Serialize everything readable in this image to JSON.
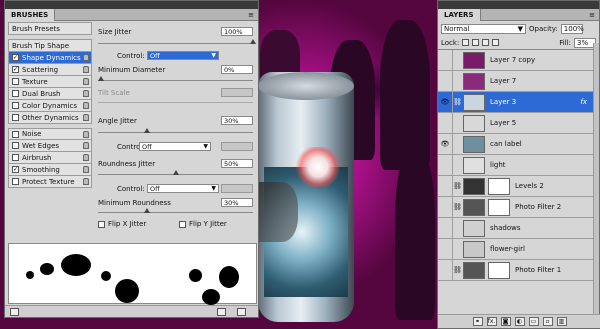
{
  "brushes_panel": {
    "tab": "BRUSHES",
    "presets_label": "Brush Presets",
    "tip_shape_label": "Brush Tip Shape",
    "options": [
      {
        "label": "Shape Dynamics",
        "checked": true,
        "selected": true
      },
      {
        "label": "Scattering",
        "checked": true,
        "selected": false
      },
      {
        "label": "Texture",
        "checked": false,
        "selected": false
      },
      {
        "label": "Dual Brush",
        "checked": false,
        "selected": false
      },
      {
        "label": "Color Dynamics",
        "checked": false,
        "selected": false
      },
      {
        "label": "Other Dynamics",
        "checked": false,
        "selected": false
      },
      {
        "label": "Noise",
        "checked": false,
        "selected": false
      },
      {
        "label": "Wet Edges",
        "checked": false,
        "selected": false
      },
      {
        "label": "Airbrush",
        "checked": false,
        "selected": false
      },
      {
        "label": "Smoothing",
        "checked": true,
        "selected": false
      },
      {
        "label": "Protect Texture",
        "checked": false,
        "selected": false
      }
    ],
    "size_jitter_label": "Size Jitter",
    "size_jitter_value": "100%",
    "control_label": "Control:",
    "control1_value": "Off",
    "min_diameter_label": "Minimum Diameter",
    "min_diameter_value": "0%",
    "tilt_scale_label": "Tilt Scale",
    "angle_jitter_label": "Angle Jitter",
    "angle_jitter_value": "30%",
    "control2_value": "Off",
    "roundness_jitter_label": "Roundness Jitter",
    "roundness_jitter_value": "50%",
    "control3_value": "Off",
    "min_roundness_label": "Minimum Roundness",
    "min_roundness_value": "30%",
    "flip_x_label": "Flip X Jitter",
    "flip_y_label": "Flip Y Jitter"
  },
  "layers_panel": {
    "tab": "LAYERS",
    "blend_mode": "Normal",
    "opacity_label": "Opacity:",
    "opacity_value": "100%",
    "lock_label": "Lock:",
    "fill_label": "Fill:",
    "fill_value": "3%",
    "layers": [
      {
        "name": "Layer 7 copy",
        "visible": false,
        "selected": false,
        "thumb": "#7a1a6a"
      },
      {
        "name": "Layer 7",
        "visible": false,
        "selected": false,
        "thumb": "#8a2a7a"
      },
      {
        "name": "Layer 3",
        "visible": true,
        "selected": true,
        "thumb": "#c9d6df",
        "fx": "fx"
      },
      {
        "name": "Layer 5",
        "visible": false,
        "selected": false,
        "thumb": "#d8d8d8"
      },
      {
        "name": "can label",
        "visible": true,
        "selected": false,
        "thumb": "#6e8fa0"
      },
      {
        "name": "light",
        "visible": false,
        "selected": false,
        "thumb": "#e0e0e0"
      },
      {
        "name": "Levels 2",
        "visible": false,
        "selected": false,
        "thumb": "#333333",
        "mask": true
      },
      {
        "name": "Photo Filter 2",
        "visible": false,
        "selected": false,
        "thumb": "#555555",
        "mask": true
      },
      {
        "name": "shadows",
        "visible": false,
        "selected": false,
        "thumb": "#d0d0d0"
      },
      {
        "name": "flower-girl",
        "visible": false,
        "selected": false,
        "thumb": "#c8c8c8"
      },
      {
        "name": "Photo Filter 1",
        "visible": false,
        "selected": false,
        "thumb": "#555555",
        "mask": true
      }
    ],
    "footer_fx": "fx."
  },
  "colors": {
    "selection": "#2d6ad6",
    "panel_bg": "#d6d6d6",
    "canvas_magenta": "#c41aa0"
  }
}
